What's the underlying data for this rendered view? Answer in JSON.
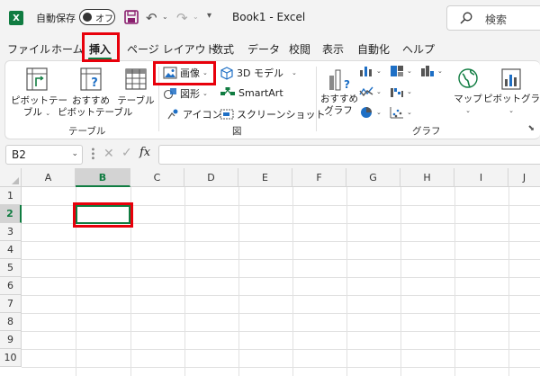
{
  "titlebar": {
    "app_badge": "X",
    "autosave_label": "自動保存",
    "autosave_state": "オフ",
    "doc_title": "Book1  -  Excel",
    "search_placeholder": "検索"
  },
  "tabs": [
    {
      "label": "ファイル",
      "active": false
    },
    {
      "label": "ホーム",
      "active": false
    },
    {
      "label": "挿入",
      "active": true
    },
    {
      "label": "ページ レイアウト",
      "active": false
    },
    {
      "label": "数式",
      "active": false
    },
    {
      "label": "データ",
      "active": false
    },
    {
      "label": "校閲",
      "active": false
    },
    {
      "label": "表示",
      "active": false
    },
    {
      "label": "自動化",
      "active": false
    },
    {
      "label": "ヘルプ",
      "active": false
    }
  ],
  "ribbon": {
    "table_group": {
      "label": "テーブル",
      "pivot_line1": "ピボットテー",
      "pivot_line2": "ブル",
      "rec_pivot_line1": "おすすめ",
      "rec_pivot_line2": "ピボットテーブル",
      "table": "テーブル"
    },
    "illustrations_group": {
      "label": "図",
      "pictures": "画像",
      "shapes": "図形",
      "icons": "アイコン",
      "models3d": "3D モデル",
      "smartart": "SmartArt",
      "screenshot": "スクリーンショット"
    },
    "charts_group": {
      "label": "グラフ",
      "rec_charts_line1": "おすすめ",
      "rec_charts_line2": "グラフ",
      "maps": "マップ",
      "pivot_chart": "ピボットグラフ"
    }
  },
  "formula_bar": {
    "name_box": "B2",
    "fx_label": "fx",
    "formula": ""
  },
  "sheet": {
    "columns": [
      "A",
      "B",
      "C",
      "D",
      "E",
      "F",
      "G",
      "H",
      "I",
      "J"
    ],
    "rows": [
      "1",
      "2",
      "3",
      "4",
      "5",
      "6",
      "7",
      "8",
      "9",
      "10"
    ],
    "active_column": "B",
    "active_row": "2"
  },
  "colors": {
    "excel_green": "#107c41",
    "highlight_red": "#e8000b"
  }
}
